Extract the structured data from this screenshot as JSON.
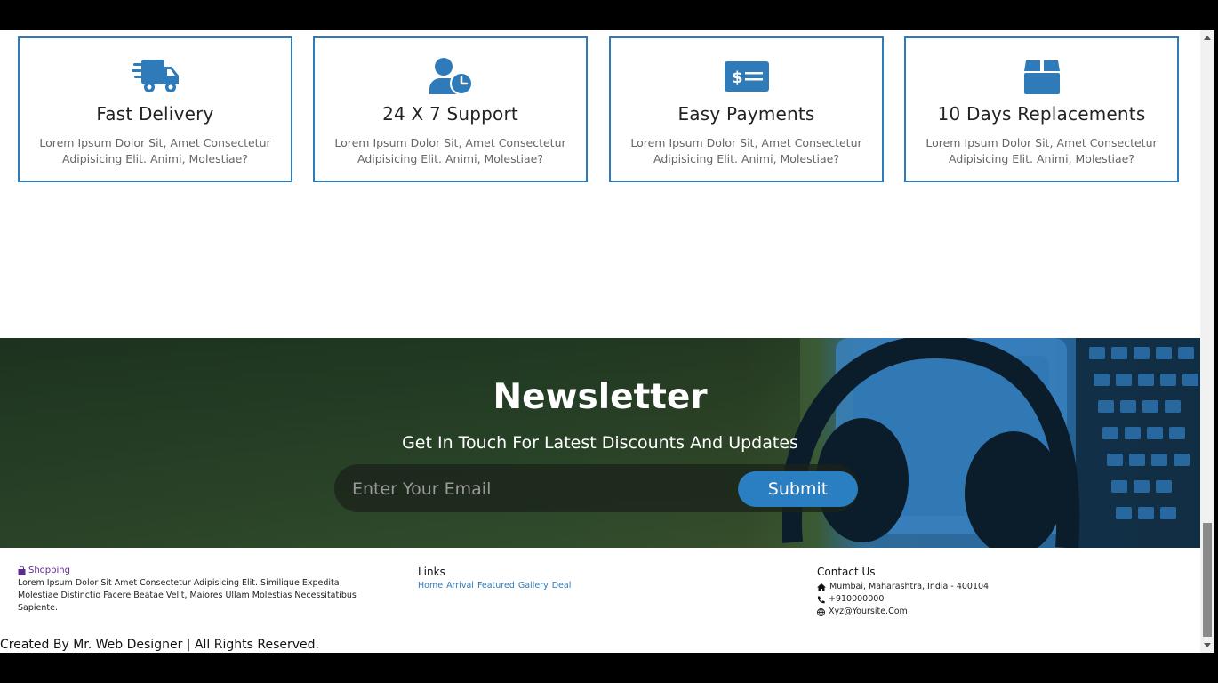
{
  "features": [
    {
      "title": "Fast Delivery",
      "text": "Lorem Ipsum Dolor Sit, Amet Consectetur Adipisicing Elit. Animi, Molestiae?",
      "icon": "truck-icon"
    },
    {
      "title": "24 X 7 Support",
      "text": "Lorem Ipsum Dolor Sit, Amet Consectetur Adipisicing Elit. Animi, Molestiae?",
      "icon": "user-clock-icon"
    },
    {
      "title": "Easy Payments",
      "text": "Lorem Ipsum Dolor Sit, Amet Consectetur Adipisicing Elit. Animi, Molestiae?",
      "icon": "money-card-icon"
    },
    {
      "title": "10 Days Replacements",
      "text": "Lorem Ipsum Dolor Sit, Amet Consectetur Adipisicing Elit. Animi, Molestiae?",
      "icon": "box-icon"
    }
  ],
  "newsletter": {
    "title": "Newsletter",
    "subtitle": "Get In Touch For Latest Discounts And Updates",
    "placeholder": "Enter Your Email",
    "submit_label": "Submit"
  },
  "footer": {
    "brand": "Shopping",
    "description": "Lorem Ipsum Dolor Sit Amet Consectetur Adipisicing Elit. Similique Expedita Molestiae Distinctio Facere Beatae Velit, Maiores Ullam Molestias Necessitatibus Sapiente.",
    "links_heading": "Links",
    "links": [
      "Home",
      "Arrival",
      "Featured",
      "Gallery",
      "Deal"
    ],
    "contact_heading": "Contact Us",
    "address": "Mumbai, Maharashtra, India - 400104",
    "phone": "+910000000",
    "email": "Xyz@Yoursite.Com",
    "credit": "Created By Mr. Web Designer | All Rights Reserved."
  },
  "colors": {
    "accent": "#2f7ab8",
    "brand": "#5b2b8a"
  }
}
